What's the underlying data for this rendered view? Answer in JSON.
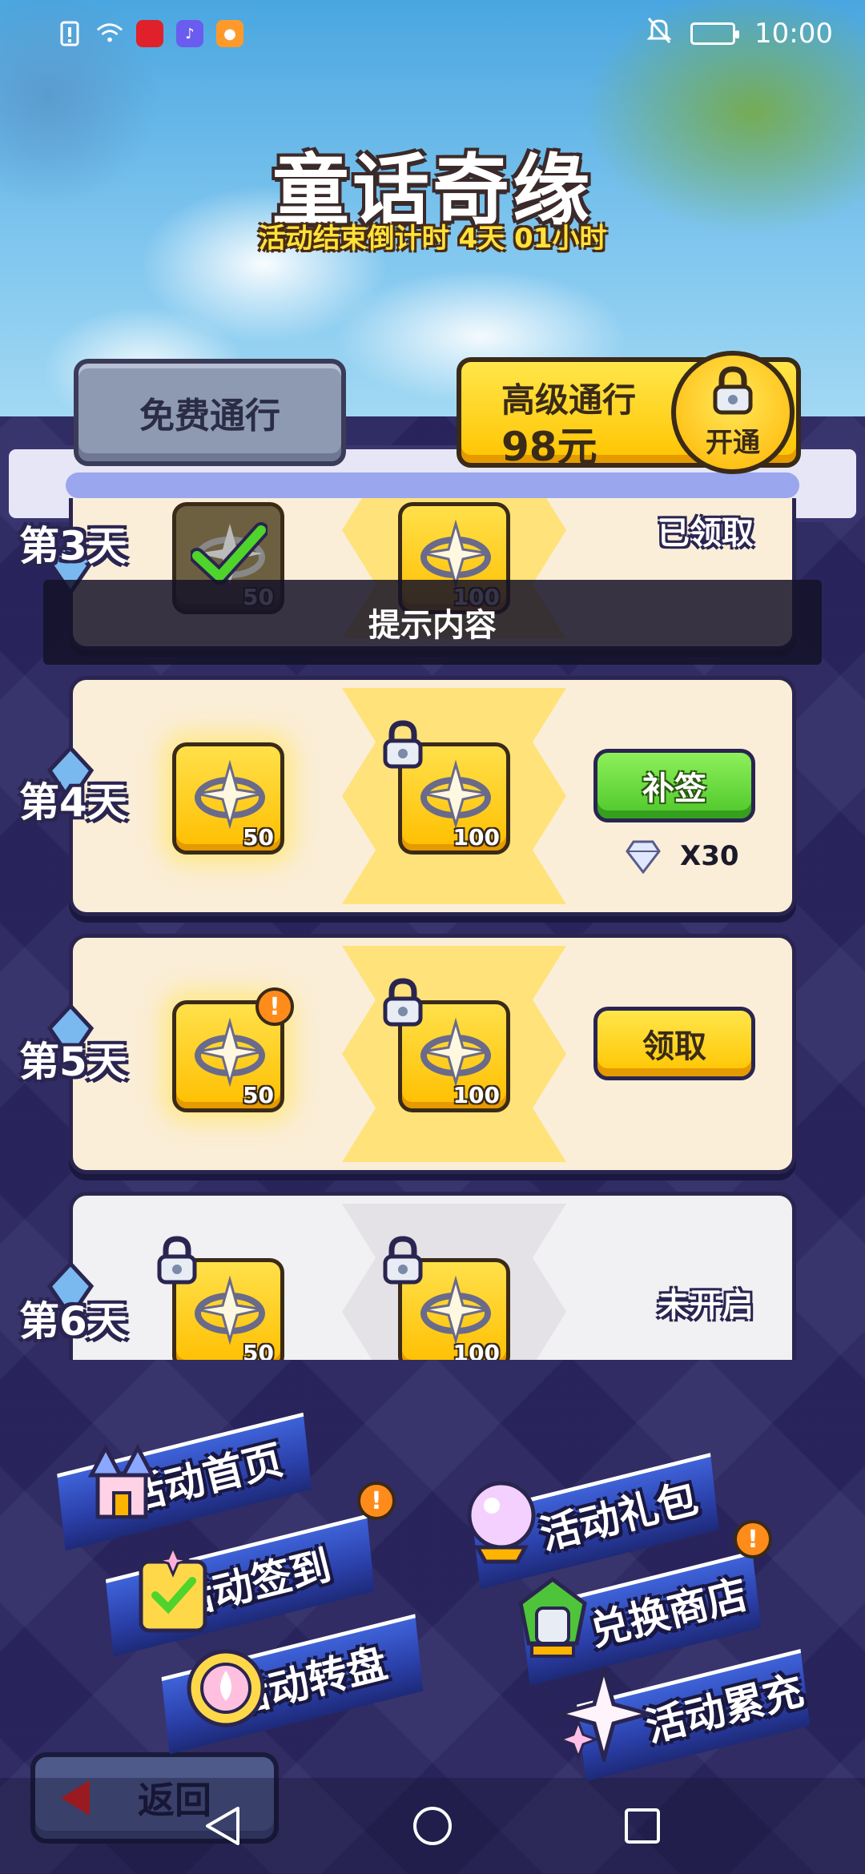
{
  "statusbar": {
    "time": "10:00"
  },
  "header": {
    "title": "童话奇缘",
    "countdown": "活动结束倒计时 4天 01小时"
  },
  "pass": {
    "free_label": "免费通行",
    "premium_label": "高级通行",
    "premium_price": "98元",
    "unlock_label": "开通"
  },
  "tooltip": {
    "text": "提示内容"
  },
  "rows": [
    {
      "day": "第3天",
      "free_qty": "50",
      "premium_qty": "100",
      "status": "已领取"
    },
    {
      "day": "第4天",
      "free_qty": "50",
      "premium_qty": "100",
      "button": "补签",
      "cost_qty": "X30"
    },
    {
      "day": "第5天",
      "free_qty": "50",
      "premium_qty": "100",
      "button": "领取"
    },
    {
      "day": "第6天",
      "free_qty": "50",
      "premium_qty": "100",
      "status": "未开启"
    }
  ],
  "menu": {
    "home": "活动首页",
    "signin": "活动签到",
    "wheel": "活动转盘",
    "gift": "活动礼包",
    "shop": "兑换商店",
    "recharge": "活动累充",
    "alert_mark": "!"
  },
  "back_label": "返回",
  "colors": {
    "accent_yellow": "#ffc400",
    "accent_green": "#4cc62a",
    "background": "#2c2763"
  }
}
